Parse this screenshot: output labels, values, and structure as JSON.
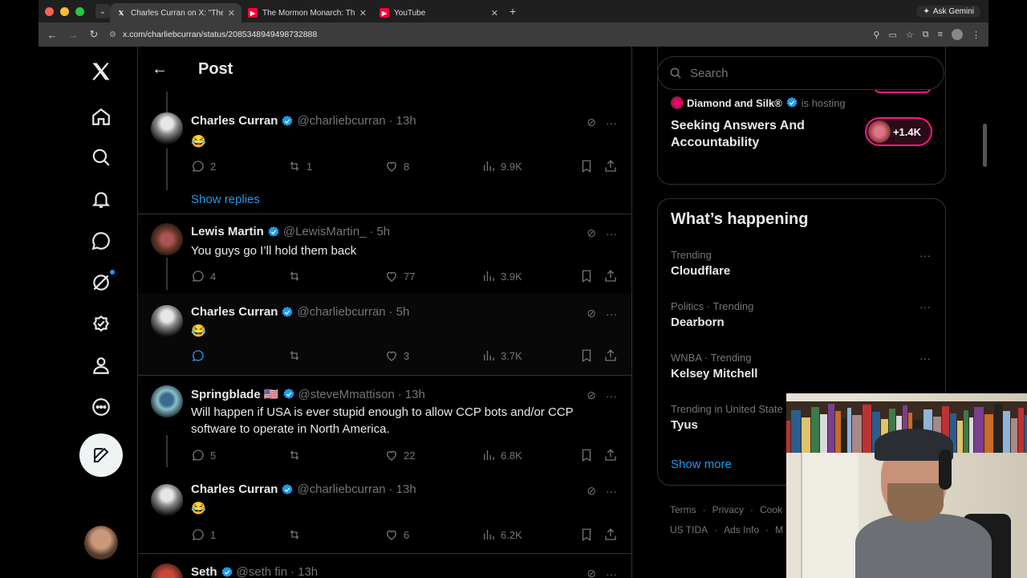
{
  "browser": {
    "tabs": [
      {
        "title": "Charles Curran on X: \"The ye",
        "favicon": "X",
        "active": true
      },
      {
        "title": "The Mormon Monarch: The Ji",
        "favicon": "youtube",
        "active": false
      },
      {
        "title": "YouTube",
        "favicon": "youtube",
        "active": false
      }
    ],
    "gemini_label": "Ask Gemini",
    "url": "x.com/charliebcurran/status/2085348949498732888"
  },
  "header": {
    "title": "Post"
  },
  "tweets": [
    {
      "name": "Charles Curran",
      "handle": "@charliebcurran",
      "time": "13h",
      "text": "😂",
      "replies": "2",
      "retweets": "1",
      "likes": "8",
      "views": "9.9K"
    },
    {
      "name": "Lewis Martin",
      "handle": "@LewisMartin_",
      "time": "5h",
      "text": "You guys go I’ll hold them back",
      "replies": "4",
      "retweets": "",
      "likes": "77",
      "views": "3.9K"
    },
    {
      "name": "Charles Curran",
      "handle": "@charliebcurran",
      "time": "5h",
      "text": "😂",
      "replies": "",
      "retweets": "",
      "likes": "3",
      "views": "3.7K"
    },
    {
      "name": "Springblade 🇺🇸",
      "handle": "@steveMmattison",
      "time": "13h",
      "text": "Will happen if USA is ever stupid enough to allow CCP bots and/or CCP software to operate in North America.",
      "replies": "5",
      "retweets": "",
      "likes": "22",
      "views": "6.8K"
    },
    {
      "name": "Charles Curran",
      "handle": "@charliebcurran",
      "time": "13h",
      "text": "😂",
      "replies": "1",
      "retweets": "",
      "likes": "6",
      "views": "6.2K"
    },
    {
      "name": "Seth",
      "handle": "@seth fin",
      "time": "13h",
      "text": "",
      "replies": "",
      "retweets": "",
      "likes": "",
      "views": ""
    }
  ],
  "show_replies": "Show replies",
  "search": {
    "placeholder": "Search"
  },
  "space": {
    "host": "Diamond and Silk®",
    "hosting": "is hosting",
    "title": "Seeking Answers And Accountability",
    "listeners": "+1.4K"
  },
  "whats_happening": {
    "title": "What’s happening",
    "trends": [
      {
        "context": "Trending",
        "topic": "Cloudflare"
      },
      {
        "context": "Politics · Trending",
        "topic": "Dearborn"
      },
      {
        "context": "WNBA · Trending",
        "topic": "Kelsey Mitchell"
      },
      {
        "context": "Trending in United State",
        "topic": "Tyus"
      }
    ],
    "show_more": "Show more"
  },
  "footer": {
    "row1": [
      "Terms",
      "·",
      "Privacy",
      "·",
      "Cook"
    ],
    "row2": [
      "US TIDA",
      "·",
      "Ads Info",
      "·",
      "M"
    ]
  },
  "colors": {
    "accent": "#1d9bf0",
    "verified": "#1d9bf0",
    "space_border": "#f91880",
    "muted": "#71767b"
  }
}
